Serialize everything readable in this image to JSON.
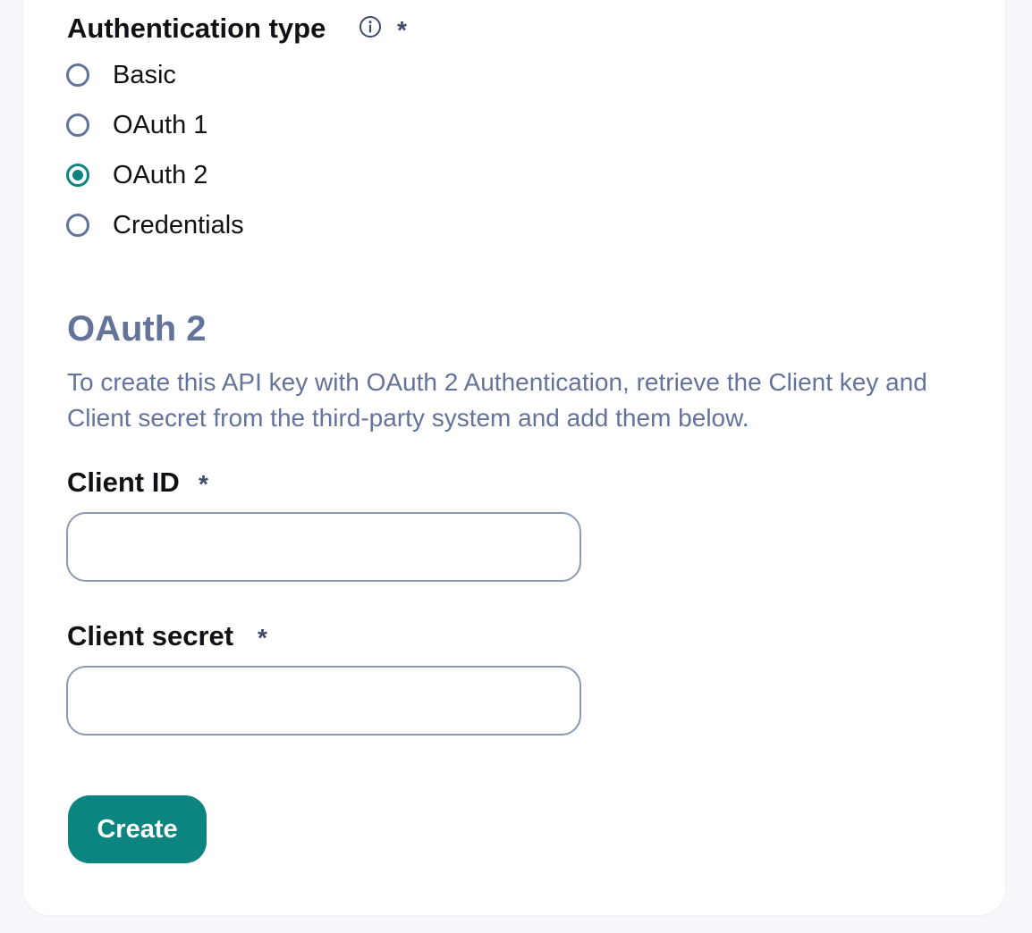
{
  "auth_type": {
    "label": "Authentication type",
    "required_marker": "*",
    "info_icon": "info-circle-icon",
    "options": [
      {
        "label": "Basic",
        "checked": false
      },
      {
        "label": "OAuth 1",
        "checked": false
      },
      {
        "label": "OAuth 2",
        "checked": true
      },
      {
        "label": "Credentials",
        "checked": false
      }
    ]
  },
  "oauth2_section": {
    "heading": "OAuth 2",
    "description": "To create this API key with OAuth 2 Authentication, retrieve the Client key and Client secret from the third-party system and add them below."
  },
  "client_id": {
    "label": "Client ID",
    "required_marker": "*",
    "value": "",
    "placeholder": ""
  },
  "client_secret": {
    "label": "Client secret",
    "required_marker": "*",
    "value": "",
    "placeholder": ""
  },
  "create_button": {
    "label": "Create"
  },
  "colors": {
    "accent": "#0c8480",
    "muted_text": "#64739a",
    "input_border": "#8e9ab3",
    "page_background": "#f7f8fb"
  }
}
